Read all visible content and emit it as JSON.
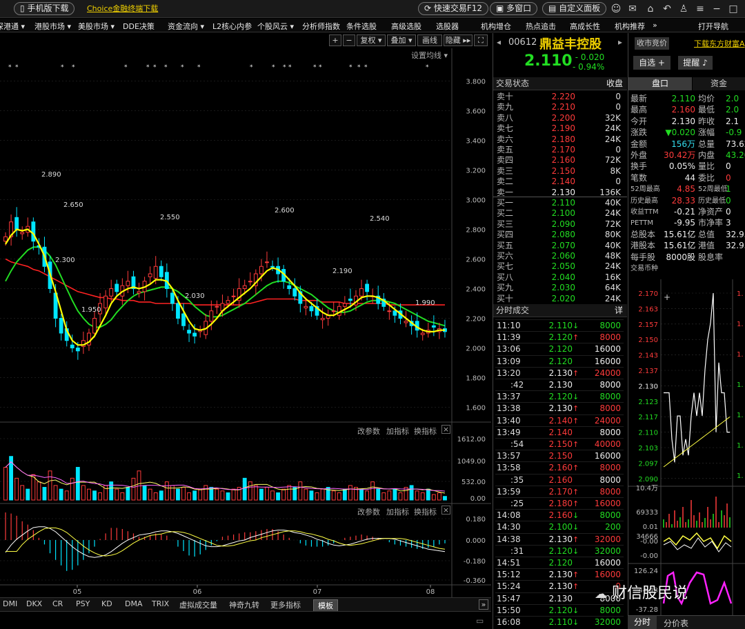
{
  "topbar": {
    "mobile_download": "手机版下载",
    "choice_link": "Choice金融终端下载",
    "quick_trade": "快速交易F12",
    "multi_window": "多窗口",
    "custom_panel": "自定义面板"
  },
  "menu": [
    "深港通 ▾",
    "港股市场 ▾",
    "美股市场 ▾",
    "DDE决策",
    "资金流向 ▾",
    "L2核心内参",
    "个股风云 ▾",
    "分析师指数",
    "条件选股",
    "高级选股",
    "选股器",
    "机构增仓",
    "热点追击",
    "高成长性",
    "机构推荐",
    "»",
    "打开导航"
  ],
  "chart_toolbar": {
    "plus": "+",
    "minus": "−",
    "fuquan": "复权 ▾",
    "overlay": "叠加 ▾",
    "draw": "画线",
    "hide": "隐藏 ▸▸",
    "fullscreen": "⛶",
    "ma_settings": "设置均线 ▾"
  },
  "stock": {
    "code": "00612",
    "name": "鼎益丰控股",
    "price": "2.110",
    "change": "- 0.020",
    "change_pct": "- 0.94%",
    "close_auction_btn": "收市竞价",
    "download_link": "下载东方财富A",
    "watchlist_btn": "自选 +",
    "alert_btn": "提醒",
    "trade_status_label": "交易状态",
    "trade_status_value": "收盘",
    "tab_pankou": "盘口",
    "tab_fund": "资金"
  },
  "asks": [
    {
      "label": "卖十",
      "price": "2.220",
      "vol": "0"
    },
    {
      "label": "卖九",
      "price": "2.210",
      "vol": "0"
    },
    {
      "label": "卖八",
      "price": "2.200",
      "vol": "32K"
    },
    {
      "label": "卖七",
      "price": "2.190",
      "vol": "24K"
    },
    {
      "label": "卖六",
      "price": "2.180",
      "vol": "24K"
    },
    {
      "label": "卖五",
      "price": "2.170",
      "vol": "0"
    },
    {
      "label": "卖四",
      "price": "2.160",
      "vol": "72K"
    },
    {
      "label": "卖三",
      "price": "2.150",
      "vol": "8K"
    },
    {
      "label": "卖二",
      "price": "2.140",
      "vol": "0"
    },
    {
      "label": "卖一",
      "price": "2.130",
      "vol": "136K"
    }
  ],
  "bids": [
    {
      "label": "买一",
      "price": "2.110",
      "vol": "40K"
    },
    {
      "label": "买二",
      "price": "2.100",
      "vol": "24K"
    },
    {
      "label": "买三",
      "price": "2.090",
      "vol": "72K"
    },
    {
      "label": "买四",
      "price": "2.080",
      "vol": "80K"
    },
    {
      "label": "买五",
      "price": "2.070",
      "vol": "40K"
    },
    {
      "label": "买六",
      "price": "2.060",
      "vol": "48K"
    },
    {
      "label": "买七",
      "price": "2.050",
      "vol": "24K"
    },
    {
      "label": "买八",
      "price": "2.040",
      "vol": "16K"
    },
    {
      "label": "买九",
      "price": "2.030",
      "vol": "64K"
    },
    {
      "label": "买十",
      "price": "2.020",
      "vol": "24K"
    }
  ],
  "ticks_header": {
    "label": "分时成交",
    "detail": "详"
  },
  "ticks": [
    {
      "time": "11:10",
      "price": "2.110",
      "dir": "↓",
      "vol": "8000",
      "c": "grn"
    },
    {
      "time": "11:39",
      "price": "2.120",
      "dir": "↑",
      "vol": "8000",
      "c": "grn"
    },
    {
      "time": "13:06",
      "price": "2.120",
      "dir": "",
      "vol": "16000",
      "c": "grn"
    },
    {
      "time": "13:09",
      "price": "2.120",
      "dir": "",
      "vol": "16000",
      "c": "grn"
    },
    {
      "time": "13:20",
      "price": "2.130",
      "dir": "↑",
      "vol": "24000",
      "c": "wht"
    },
    {
      "time": ":42",
      "price": "2.130",
      "dir": "",
      "vol": "8000",
      "c": "wht"
    },
    {
      "time": "13:37",
      "price": "2.120",
      "dir": "↓",
      "vol": "8000",
      "c": "grn"
    },
    {
      "time": "13:38",
      "price": "2.130",
      "dir": "↑",
      "vol": "8000",
      "c": "wht"
    },
    {
      "time": "13:40",
      "price": "2.140",
      "dir": "↑",
      "vol": "24000",
      "c": "red"
    },
    {
      "time": "13:49",
      "price": "2.140",
      "dir": "",
      "vol": "8000",
      "c": "red"
    },
    {
      "time": ":54",
      "price": "2.150",
      "dir": "↑",
      "vol": "40000",
      "c": "red"
    },
    {
      "time": "13:57",
      "price": "2.150",
      "dir": "",
      "vol": "16000",
      "c": "red"
    },
    {
      "time": "13:58",
      "price": "2.160",
      "dir": "↑",
      "vol": "8000",
      "c": "red"
    },
    {
      "time": ":35",
      "price": "2.160",
      "dir": "",
      "vol": "8000",
      "c": "red"
    },
    {
      "time": "13:59",
      "price": "2.170",
      "dir": "↑",
      "vol": "8000",
      "c": "red"
    },
    {
      "time": ":25",
      "price": "2.180",
      "dir": "↑",
      "vol": "16000",
      "c": "red"
    },
    {
      "time": "14:08",
      "price": "2.160",
      "dir": "↓",
      "vol": "8000",
      "c": "red"
    },
    {
      "time": "14:30",
      "price": "2.100",
      "dir": "↓",
      "vol": "200",
      "c": "grn"
    },
    {
      "time": "14:38",
      "price": "2.130",
      "dir": "↑",
      "vol": "32000",
      "c": "wht"
    },
    {
      "time": ":31",
      "price": "2.120",
      "dir": "↓",
      "vol": "32000",
      "c": "grn"
    },
    {
      "time": "14:51",
      "price": "2.120",
      "dir": "",
      "vol": "16000",
      "c": "grn"
    },
    {
      "time": "15:12",
      "price": "2.130",
      "dir": "↑",
      "vol": "16000",
      "c": "wht"
    },
    {
      "time": "15:24",
      "price": "2.130",
      "dir": "↑",
      "vol": "0",
      "c": "wht"
    },
    {
      "time": "15:47",
      "price": "2.130",
      "dir": "",
      "vol": "8000",
      "c": "wht"
    },
    {
      "time": "15:50",
      "price": "2.120",
      "dir": "↓",
      "vol": "8000",
      "c": "grn"
    },
    {
      "time": "16:08",
      "price": "2.110",
      "dir": "↓",
      "vol": "32000",
      "c": "grn"
    }
  ],
  "quote": [
    {
      "l1": "最新",
      "v1": "2.110",
      "c1": "grn",
      "l2": "均价",
      "v2": "2.0",
      "c2": "grn"
    },
    {
      "l1": "最高",
      "v1": "2.160",
      "c1": "red",
      "l2": "最低",
      "v2": "2.0",
      "c2": "grn"
    },
    {
      "l1": "今开",
      "v1": "2.130",
      "c1": "wht",
      "l2": "昨收",
      "v2": "2.1",
      "c2": "wht"
    },
    {
      "l1": "涨跌",
      "v1": "▼0.020",
      "c1": "grn",
      "l2": "涨幅",
      "v2": "-0.9",
      "c2": "grn"
    },
    {
      "l1": "金额",
      "v1": "156万",
      "c1": "cyn",
      "l2": "总量",
      "v2": "73.62",
      "c2": "wht"
    },
    {
      "l1": "外盘",
      "v1": "30.42万",
      "c1": "red",
      "l2": "内盘",
      "v2": "43.20",
      "c2": "grn"
    },
    {
      "l1": "换手",
      "v1": "0.05%",
      "c1": "wht",
      "l2": "量比",
      "v2": "0",
      "c2": "wht"
    },
    {
      "l1": "笔数",
      "v1": "44",
      "c1": "wht",
      "l2": "委比",
      "v2": "0",
      "c2": "red"
    },
    {
      "l1": "52周最高",
      "v1": "4.85",
      "c1": "red",
      "l2": "52周最低",
      "v2": "1",
      "c2": "grn"
    },
    {
      "l1": "历史最高",
      "v1": "28.33",
      "c1": "red",
      "l2": "历史最低",
      "v2": "0",
      "c2": "grn"
    },
    {
      "l1": "收益TTM",
      "v1": "-0.21",
      "c1": "wht",
      "l2": "净资产",
      "v2": "0",
      "c2": "wht"
    },
    {
      "l1": "PETTM",
      "v1": "-9.95",
      "c1": "wht",
      "l2": "市净率",
      "v2": "3",
      "c2": "wht"
    },
    {
      "l1": "总股本",
      "v1": "15.61亿",
      "c1": "wht",
      "l2": "总值",
      "v2": "32.95",
      "c2": "wht"
    },
    {
      "l1": "港股本",
      "v1": "15.61亿",
      "c1": "wht",
      "l2": "港值",
      "v2": "32.95",
      "c2": "wht"
    },
    {
      "l1": "每手股",
      "v1": "8000股",
      "c1": "wht",
      "l2": "股息率",
      "v2": "",
      "c2": "wht"
    },
    {
      "l1": "交易币种",
      "v1": "",
      "c1": "wht",
      "l2": "",
      "v2": "",
      "c2": "wht"
    }
  ],
  "intraday_axis": [
    "2.170",
    "2.163",
    "2.157",
    "2.150",
    "2.143",
    "2.137",
    "2.130",
    "2.123",
    "2.117",
    "2.110",
    "2.103",
    "2.097",
    "2.090"
  ],
  "intraday_right": [
    "1.",
    "1.",
    "1.",
    "1.",
    "1.",
    "1.",
    "1."
  ],
  "intraday_vol_axis": [
    "10.4万",
    "69333",
    "34666"
  ],
  "intraday_ind_axis": [
    "0.01",
    "-0.00",
    "-0.00"
  ],
  "intraday_ind2_axis": [
    "126.24",
    "44.48",
    "-37.28"
  ],
  "far_tabs": {
    "a": "分时",
    "b": "分价表"
  },
  "watermark": "财信股民说",
  "bottom_tabs": [
    "DMI",
    "DKX",
    "CR",
    "PSY",
    "KD",
    "DMA",
    "TRIX",
    "虚拟成交量",
    "神奇九转",
    "更多指标",
    "模板"
  ],
  "panel_links": {
    "change_param": "改参数",
    "add_ind": "加指标",
    "switch_ind": "换指标"
  },
  "price_axis": [
    "3.800",
    "3.600",
    "3.400",
    "3.200",
    "3.000",
    "2.800",
    "2.600",
    "2.400",
    "2.200",
    "2.000",
    "1.800",
    "1.600"
  ],
  "vol_axis": [
    "1612.00",
    "1049.00",
    "532.00",
    "0.00"
  ],
  "macd_axis": [
    "0.180",
    "0.000",
    "-0.180",
    "-0.360"
  ],
  "date_axis": [
    "05",
    "06",
    "07",
    "08"
  ],
  "annotations": [
    "2.890",
    "2.650",
    "2.550",
    "2.600",
    "2.540",
    "2.190",
    "2.030",
    "1.950",
    "1.990",
    "2.300"
  ],
  "colors": {
    "up": "#ff3b3b",
    "down": "#00e5ff",
    "ma5": "#ffff00",
    "ma10": "#22dd22",
    "ma20": "#ff2222",
    "bg": "#000000"
  },
  "chart_data": {
    "type": "candlestick",
    "ylim": [
      1.5,
      3.9
    ],
    "close": [
      2.75,
      2.85,
      2.8,
      2.78,
      2.82,
      2.72,
      2.68,
      2.55,
      2.4,
      2.2,
      2.1,
      2.05,
      2.0,
      1.98,
      2.05,
      2.1,
      2.2,
      2.3,
      2.35,
      2.4,
      2.38,
      2.42,
      2.45,
      2.4,
      2.38,
      2.45,
      2.5,
      2.55,
      2.48,
      2.4,
      2.3,
      2.2,
      2.15,
      2.1,
      2.08,
      2.12,
      2.18,
      2.25,
      2.28,
      2.3,
      2.32,
      2.35,
      2.4,
      2.42,
      2.45,
      2.5,
      2.55,
      2.58,
      2.55,
      2.5,
      2.45,
      2.4,
      2.35,
      2.3,
      2.28,
      2.25,
      2.22,
      2.2,
      2.22,
      2.25,
      2.28,
      2.3,
      2.32,
      2.35,
      2.4,
      2.38,
      2.35,
      2.3,
      2.28,
      2.25,
      2.22,
      2.2,
      2.18,
      2.15,
      2.12,
      2.1,
      2.12,
      2.14,
      2.13,
      2.11
    ],
    "ma5": [
      2.7,
      2.76,
      2.8,
      2.79,
      2.8,
      2.77,
      2.7,
      2.62,
      2.5,
      2.38,
      2.25,
      2.12,
      2.05,
      2.02,
      2.02,
      2.04,
      2.08,
      2.15,
      2.22,
      2.3,
      2.35,
      2.38,
      2.4,
      2.41,
      2.4,
      2.41,
      2.43,
      2.46,
      2.46,
      2.45,
      2.4,
      2.32,
      2.25,
      2.18,
      2.13,
      2.12,
      2.13,
      2.16,
      2.2,
      2.25,
      2.28,
      2.31,
      2.34,
      2.37,
      2.4,
      2.44,
      2.48,
      2.52,
      2.54,
      2.53,
      2.5,
      2.46,
      2.42,
      2.37,
      2.33,
      2.3,
      2.27,
      2.24,
      2.22,
      2.22,
      2.24,
      2.26,
      2.28,
      2.31,
      2.34,
      2.35,
      2.35,
      2.34,
      2.32,
      2.29,
      2.26,
      2.23,
      2.2,
      2.17,
      2.14,
      2.12,
      2.11,
      2.11,
      2.12,
      2.12
    ],
    "ma10": [
      2.45,
      2.52,
      2.58,
      2.62,
      2.66,
      2.68,
      2.68,
      2.66,
      2.62,
      2.56,
      2.48,
      2.4,
      2.32,
      2.25,
      2.2,
      2.16,
      2.14,
      2.14,
      2.16,
      2.19,
      2.24,
      2.28,
      2.32,
      2.35,
      2.37,
      2.38,
      2.39,
      2.4,
      2.41,
      2.41,
      2.4,
      2.38,
      2.35,
      2.32,
      2.28,
      2.25,
      2.22,
      2.21,
      2.21,
      2.22,
      2.24,
      2.26,
      2.28,
      2.3,
      2.33,
      2.36,
      2.39,
      2.42,
      2.44,
      2.45,
      2.45,
      2.44,
      2.42,
      2.4,
      2.38,
      2.36,
      2.33,
      2.3,
      2.27,
      2.25,
      2.24,
      2.24,
      2.25,
      2.27,
      2.29,
      2.31,
      2.32,
      2.32,
      2.32,
      2.31,
      2.3,
      2.28,
      2.26,
      2.24,
      2.22,
      2.2,
      2.18,
      2.17,
      2.16,
      2.15
    ],
    "ma20": [
      2.6,
      2.58,
      2.57,
      2.56,
      2.55,
      2.53,
      2.52,
      2.5,
      2.48,
      2.46,
      2.44,
      2.42,
      2.4,
      2.38,
      2.37,
      2.36,
      2.35,
      2.34,
      2.34,
      2.33,
      2.33,
      2.32,
      2.32,
      2.32,
      2.31,
      2.31,
      2.31,
      2.3,
      2.3,
      2.3,
      2.3,
      2.3,
      2.3,
      2.3,
      2.29,
      2.29,
      2.29,
      2.29,
      2.29,
      2.29,
      2.29,
      2.29,
      2.29,
      2.3,
      2.3,
      2.31,
      2.32,
      2.33,
      2.33,
      2.33,
      2.33,
      2.33,
      2.33,
      2.32,
      2.32,
      2.32,
      2.32,
      2.31,
      2.31,
      2.31,
      2.31,
      2.3,
      2.3,
      2.3,
      2.3,
      2.3,
      2.3,
      2.3,
      2.3,
      2.29,
      2.29,
      2.29,
      2.29,
      2.29,
      2.29,
      2.29,
      2.29,
      2.29,
      2.29,
      2.29
    ],
    "volume": [
      900,
      1200,
      600,
      400,
      300,
      700,
      500,
      350,
      800,
      400,
      300,
      250,
      600,
      900,
      400,
      300,
      250,
      200,
      400,
      500,
      300,
      200,
      350,
      600,
      800,
      400,
      300,
      200,
      250,
      500,
      400,
      300,
      350,
      200,
      250,
      300,
      400,
      350,
      300,
      250,
      200,
      300,
      350,
      600,
      500,
      400,
      300,
      350,
      250,
      200,
      300,
      400,
      350,
      500,
      300,
      250,
      200,
      300,
      350,
      250,
      200,
      300,
      400,
      350,
      300,
      250,
      500,
      300,
      200,
      250,
      300,
      200,
      350,
      400,
      250,
      200,
      300,
      150,
      200,
      100
    ]
  }
}
